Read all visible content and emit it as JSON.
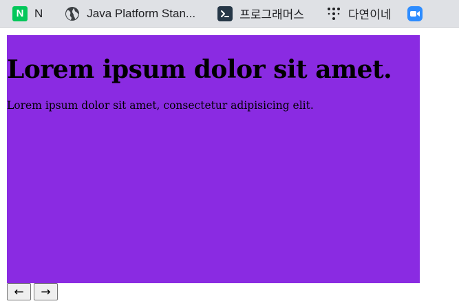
{
  "bookmarks": [
    {
      "label": "N",
      "icon": "naver-icon",
      "icon_text": "N"
    },
    {
      "label": "Java Platform Stan...",
      "icon": "globe-icon"
    },
    {
      "label": "프로그래머스",
      "icon": "programmers-icon"
    },
    {
      "label": "다연이네",
      "icon": "tree-dots-icon"
    },
    {
      "label": "",
      "icon": "zoom-icon"
    }
  ],
  "slide": {
    "heading": "Lorem ipsum dolor sit amet.",
    "body": "Lorem ipsum dolor sit amet, consectetur adipisicing elit.",
    "background_color": "#8a2be2"
  },
  "nav": {
    "prev_label": "←",
    "next_label": "→"
  }
}
